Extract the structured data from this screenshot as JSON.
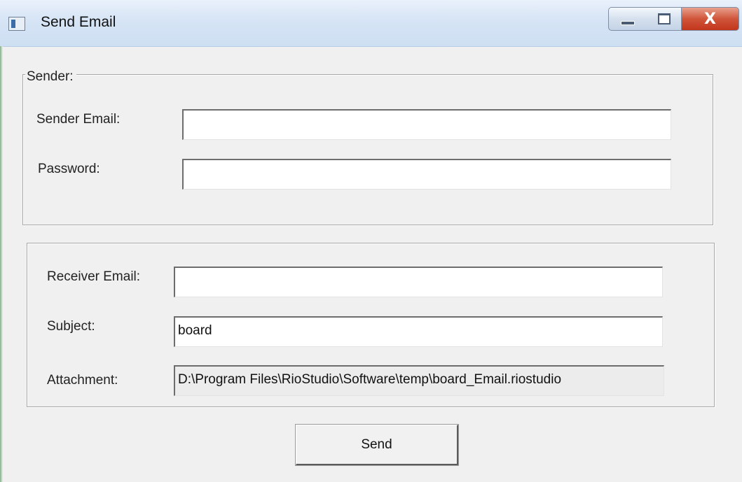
{
  "window": {
    "title": "Send Email",
    "icon": "app-window-icon",
    "controls": {
      "minimize": "minimize-icon",
      "maximize": "maximize-icon",
      "close_glyph": "X"
    }
  },
  "sender": {
    "group_label": "Sender:",
    "email_label": "Sender Email:",
    "email_value": "",
    "password_label": "Password:",
    "password_value": ""
  },
  "message": {
    "receiver_label": "Receiver Email:",
    "receiver_value": "",
    "subject_label": "Subject:",
    "subject_value": "board",
    "attachment_label": "Attachment:",
    "attachment_value": "D:\\Program Files\\RioStudio\\Software\\temp\\board_Email.riostudio"
  },
  "actions": {
    "send_label": "Send"
  },
  "colors": {
    "titlebar": "#d6e4f5",
    "close_button": "#c2361c",
    "window_bg": "#f0f0f0"
  }
}
